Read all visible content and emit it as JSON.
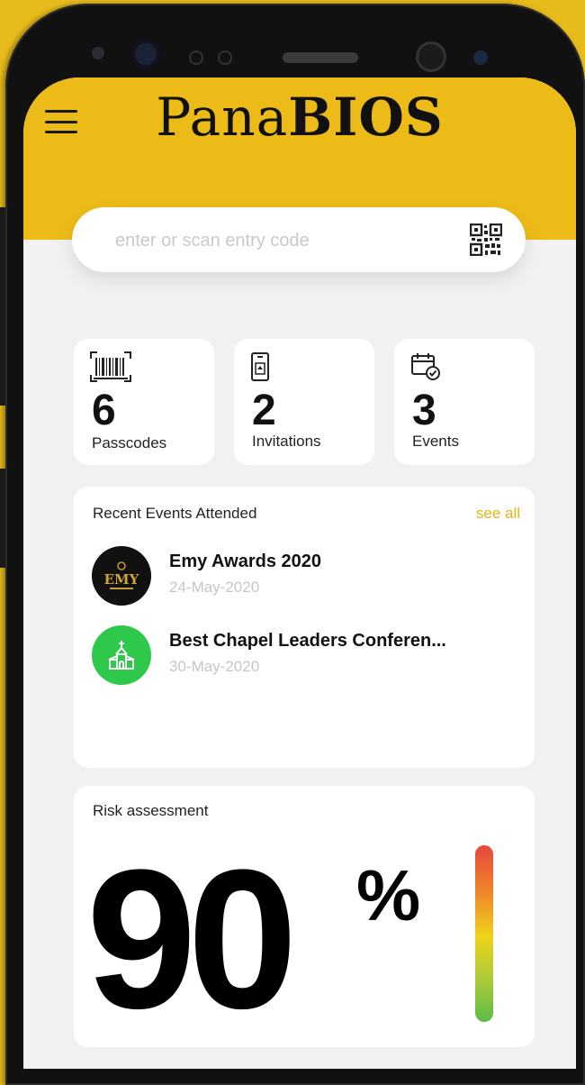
{
  "app": {
    "brand_part1": "Pana",
    "brand_part2": "BIOS"
  },
  "search": {
    "placeholder": "enter or scan entry code",
    "value": ""
  },
  "stats": [
    {
      "icon": "barcode-icon",
      "count": "6",
      "label": "Passcodes"
    },
    {
      "icon": "phone-ticket-icon",
      "count": "2",
      "label": "Invitations"
    },
    {
      "icon": "calendar-check-icon",
      "count": "3",
      "label": "Events"
    }
  ],
  "recent": {
    "title": "Recent Events Attended",
    "see_all": "see all",
    "events": [
      {
        "name": "Emy Awards 2020",
        "date": "24-May-2020",
        "avatar_text": "EMY",
        "avatar_color": "#111111"
      },
      {
        "name": "Best Chapel Leaders Conferen...",
        "date": "30-May-2020",
        "avatar_icon": "church-icon",
        "avatar_color": "#2ec84a"
      }
    ]
  },
  "risk": {
    "title": "Risk assessment",
    "value": "90",
    "unit": "%",
    "level": 0.9
  },
  "colors": {
    "brand_yellow": "#ecbb18",
    "accent_link": "#e8b417"
  }
}
